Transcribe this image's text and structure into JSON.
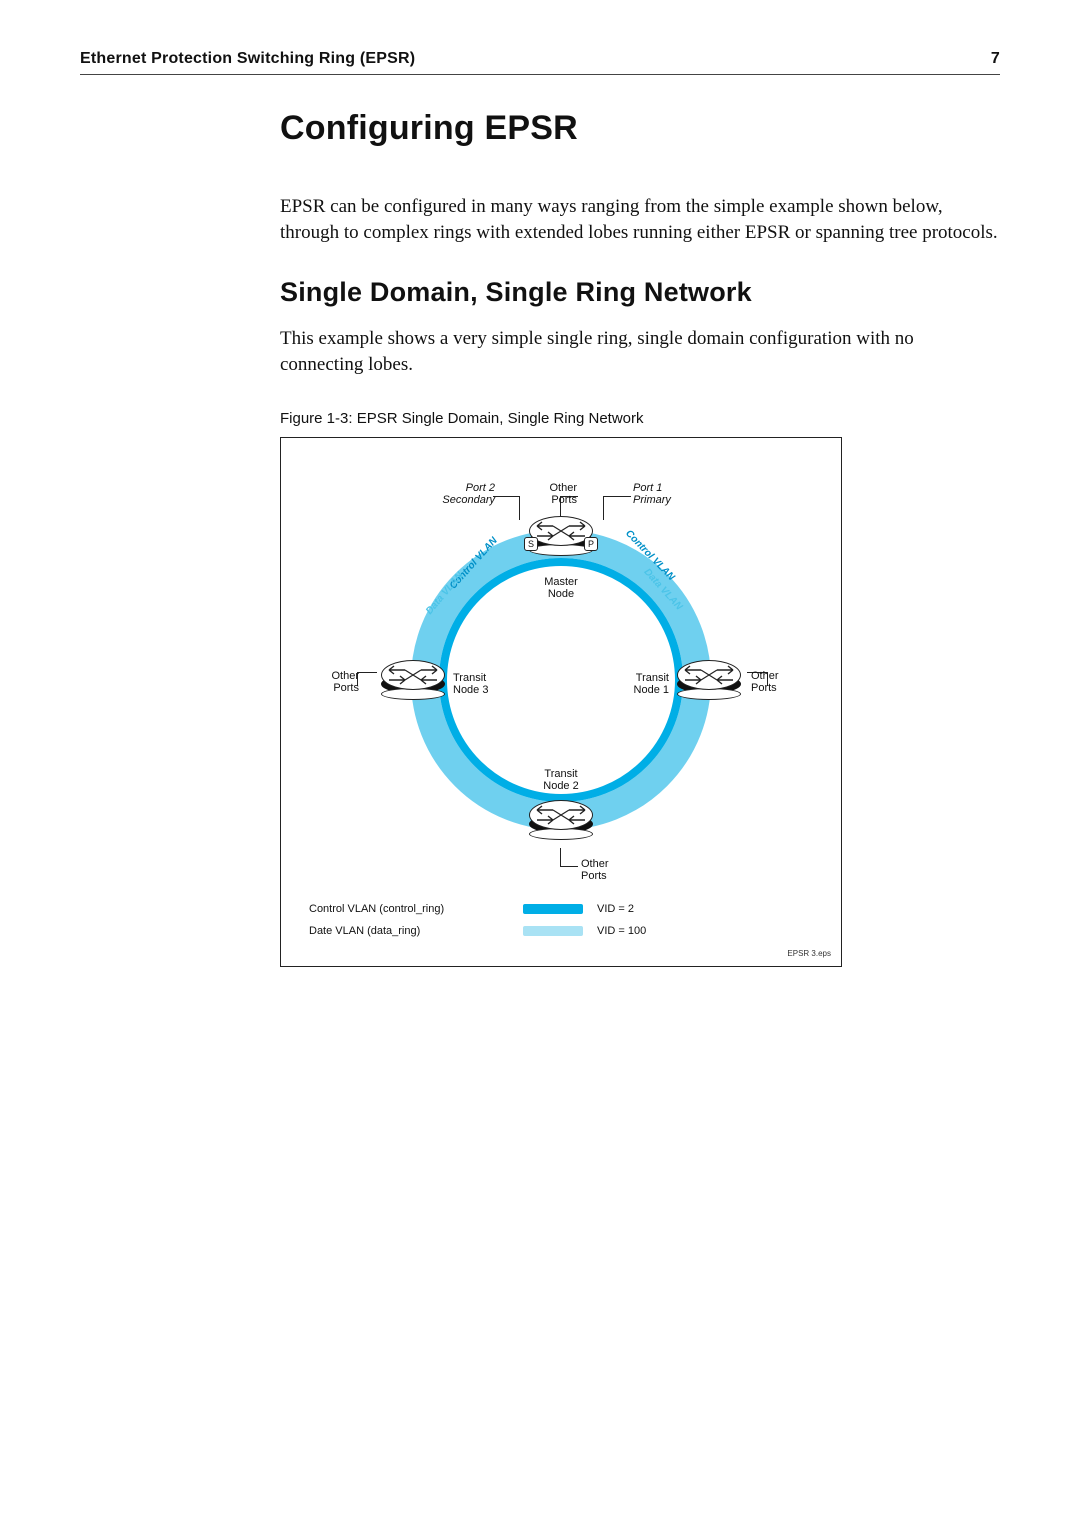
{
  "header": {
    "title": "Ethernet Protection Switching Ring (EPSR)",
    "page": "7"
  },
  "h1": "Configuring EPSR",
  "p1": "EPSR can be configured in many ways ranging from the simple example shown below, through to complex rings with extended lobes running either EPSR or spanning tree protocols.",
  "h2": "Single Domain, Single Ring Network",
  "p2": "This example shows a very simple single ring, single domain configuration with no connecting lobes.",
  "figcap": "Figure 1-3:  EPSR Single Domain, Single Ring Network",
  "diagram": {
    "port2": "Port 2",
    "secondary": "Secondary",
    "port1": "Port 1",
    "primary": "Primary",
    "other_ports": "Other",
    "other_ports2": "Ports",
    "master": "Master",
    "node": "Node",
    "transit1": "Transit",
    "node1": "Node 1",
    "transit2": "Transit",
    "node2": "Node 2",
    "transit3": "Transit",
    "node3": "Node 3",
    "s": "S",
    "p": "P",
    "ctrl_vlan": "Control VLAN",
    "data_vlan": "Data VLAN",
    "legend_ctrl": "Control VLAN (control_ring)",
    "legend_data": "Date VLAN (data_ring)",
    "vid2": "VID = 2",
    "vid100": "VID = 100",
    "eps": "EPSR 3.eps"
  }
}
